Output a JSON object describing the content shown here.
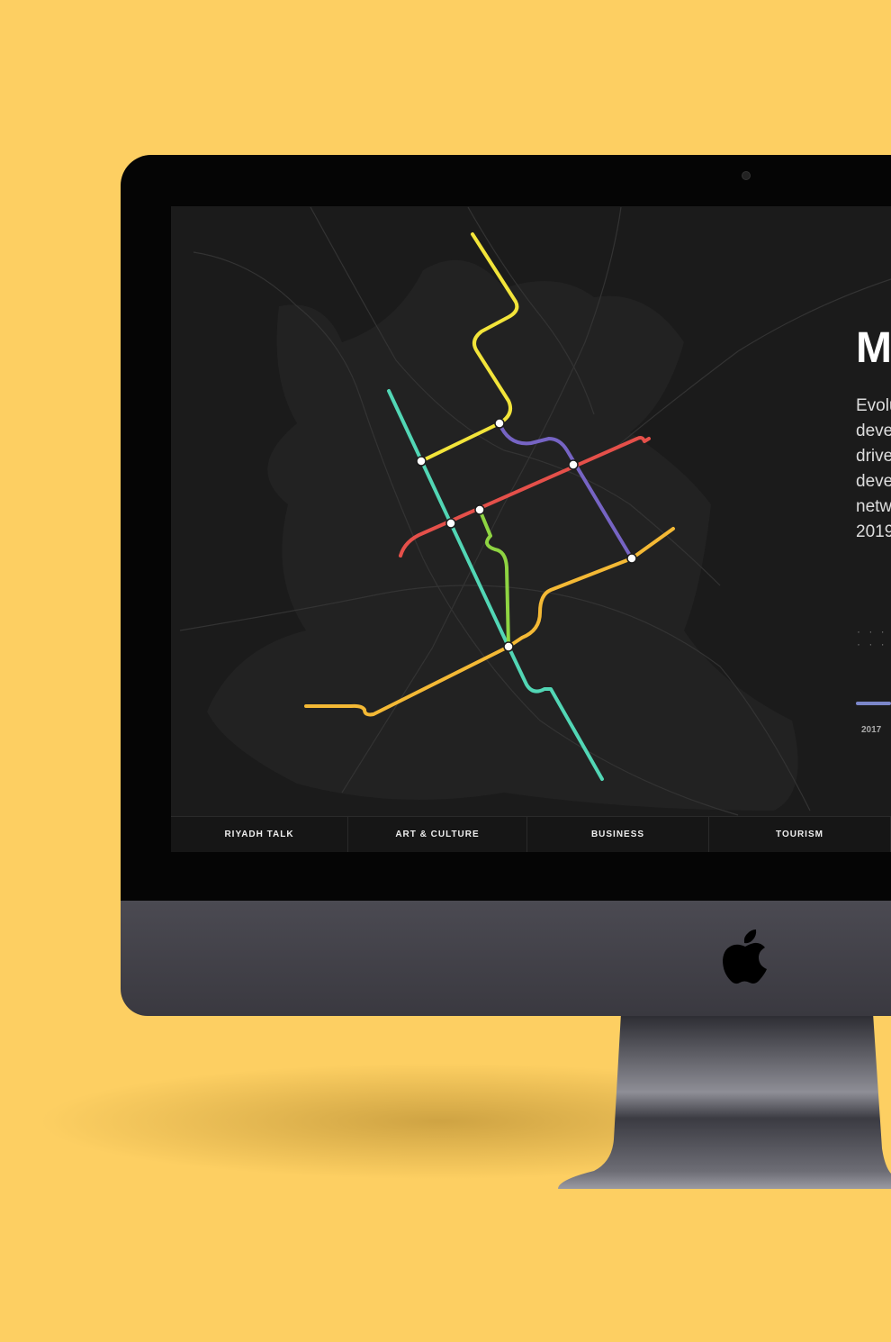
{
  "background_color": "#fdcf62",
  "panel": {
    "title": "M",
    "description_lines": [
      "Evolu",
      "deve",
      "drive",
      "deve",
      "netw",
      "2019"
    ],
    "timeline_dots": "· · · · · ·",
    "timeline_year": "2017",
    "timeline_color": "#7b86c9"
  },
  "nav": {
    "items": [
      "RIYADH TALK",
      "ART & CULTURE",
      "BUSINESS",
      "TOURISM"
    ]
  },
  "metro_lines": [
    {
      "color": "#f2e43a",
      "icon": "yellow-line"
    },
    {
      "color": "#7664c4",
      "icon": "purple-line"
    },
    {
      "color": "#e5504a",
      "icon": "red-line"
    },
    {
      "color": "#52d6b5",
      "icon": "teal-line"
    },
    {
      "color": "#8ed442",
      "icon": "green-line"
    },
    {
      "color": "#f4b935",
      "icon": "orange-line"
    }
  ],
  "device": {
    "logo": "apple-logo"
  }
}
